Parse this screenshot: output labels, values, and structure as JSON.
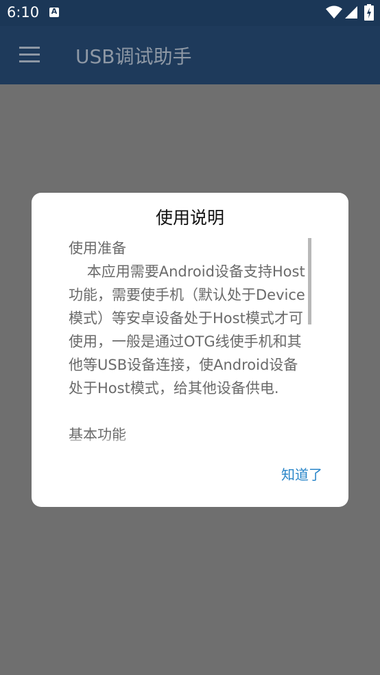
{
  "status_bar": {
    "time": "6:10",
    "notification_letter": "A",
    "icons": [
      "notification-a-icon",
      "wifi-icon",
      "signal-icon",
      "battery-icon"
    ]
  },
  "app_bar": {
    "title": "USB调试助手",
    "menu_icon": "menu-icon"
  },
  "dialog": {
    "title": "使用说明",
    "paragraphs": [
      "使用准备\n    本应用需要Android设备支持Host功能，需要使手机（默认处于Device模式）等安卓设备处于Host模式才可使用，一般是通过OTG线使手机和其他等USB设备连接，使Android设备处于Host模式，给其他设备供电.",
      "基本功能"
    ],
    "ok_label": "知道了"
  },
  "colors": {
    "status_bar": "#1b3757",
    "app_bar": "#1e3a5b",
    "scrim": "#6f6f6f",
    "accent": "#2a86c9"
  }
}
